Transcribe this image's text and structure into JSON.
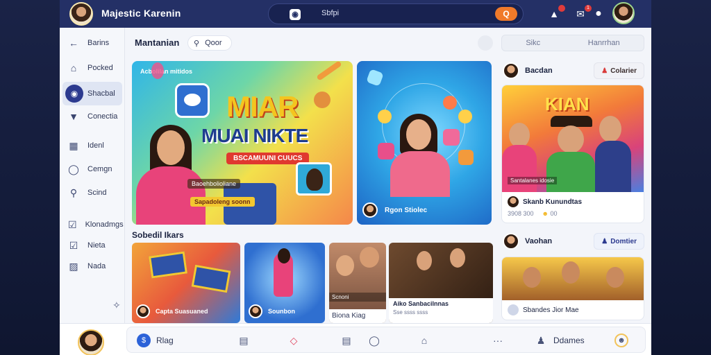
{
  "topbar": {
    "app_title": "Majestic Karenin",
    "search_text": "Sbfpi",
    "search_button": "Q",
    "notif_count": "1"
  },
  "sidebar": {
    "items": [
      {
        "label": "Barins",
        "icon": "arrow-left-icon"
      },
      {
        "label": "Pocked",
        "icon": "home-icon"
      },
      {
        "label": "Shacbal",
        "icon": "globe-icon"
      },
      {
        "label": "Conectia",
        "icon": "download-icon"
      },
      {
        "label": "Idenl",
        "icon": "id-card-icon"
      },
      {
        "label": "Cemgn",
        "icon": "book-icon"
      },
      {
        "label": "Scind",
        "icon": "search-icon"
      },
      {
        "label": "Klonadmgs",
        "icon": "checkbox-icon"
      },
      {
        "label": "Nieta",
        "icon": "check-square-icon"
      },
      {
        "label": "Nada",
        "icon": "shield-icon"
      }
    ]
  },
  "main": {
    "title": "Mantanian",
    "pill_label": "Qoor",
    "hero": {
      "kicker": "Acbolilan mitidos",
      "big_title": "MIAR",
      "big_subtitle": "MUAI NIKTE",
      "red_label": "BSCAMUUNI CUUCS",
      "caption1": "Baoehbolioliane",
      "caption2": "Sapadoleng soonn"
    },
    "card2": {
      "title": "Rgon Stiolec"
    },
    "section_title": "Sobedil Ikars",
    "thumbs": [
      {
        "caption": "Capta Suasuaned",
        "sub": ""
      },
      {
        "caption": "Sounbon",
        "sub": ""
      },
      {
        "caption": "Scnoni",
        "sub": "Biona Kiag"
      },
      {
        "caption": "Aiko Sanbacilnnas",
        "sub": "Sse ssss ssss"
      }
    ]
  },
  "rpanel": {
    "search_left": "Sikc",
    "search_right": "Hanrrhan",
    "post1": {
      "name": "Bacdan",
      "button": "Colarier",
      "image_title": "KIAN",
      "image_caption": "Santalanes idosie",
      "title": "Skanb Kunundtas",
      "stat1": "3908 300",
      "stat2": "00"
    },
    "post2": {
      "name": "Vaohan",
      "button": "Domtier",
      "caption": "Sbandes Jior Mae"
    }
  },
  "bottombar": {
    "tab1": "Rlag",
    "tab2": "Ddames"
  },
  "colors": {
    "topbar": "#243066",
    "accent": "#f07a2a",
    "active": "#2c3a8f"
  }
}
